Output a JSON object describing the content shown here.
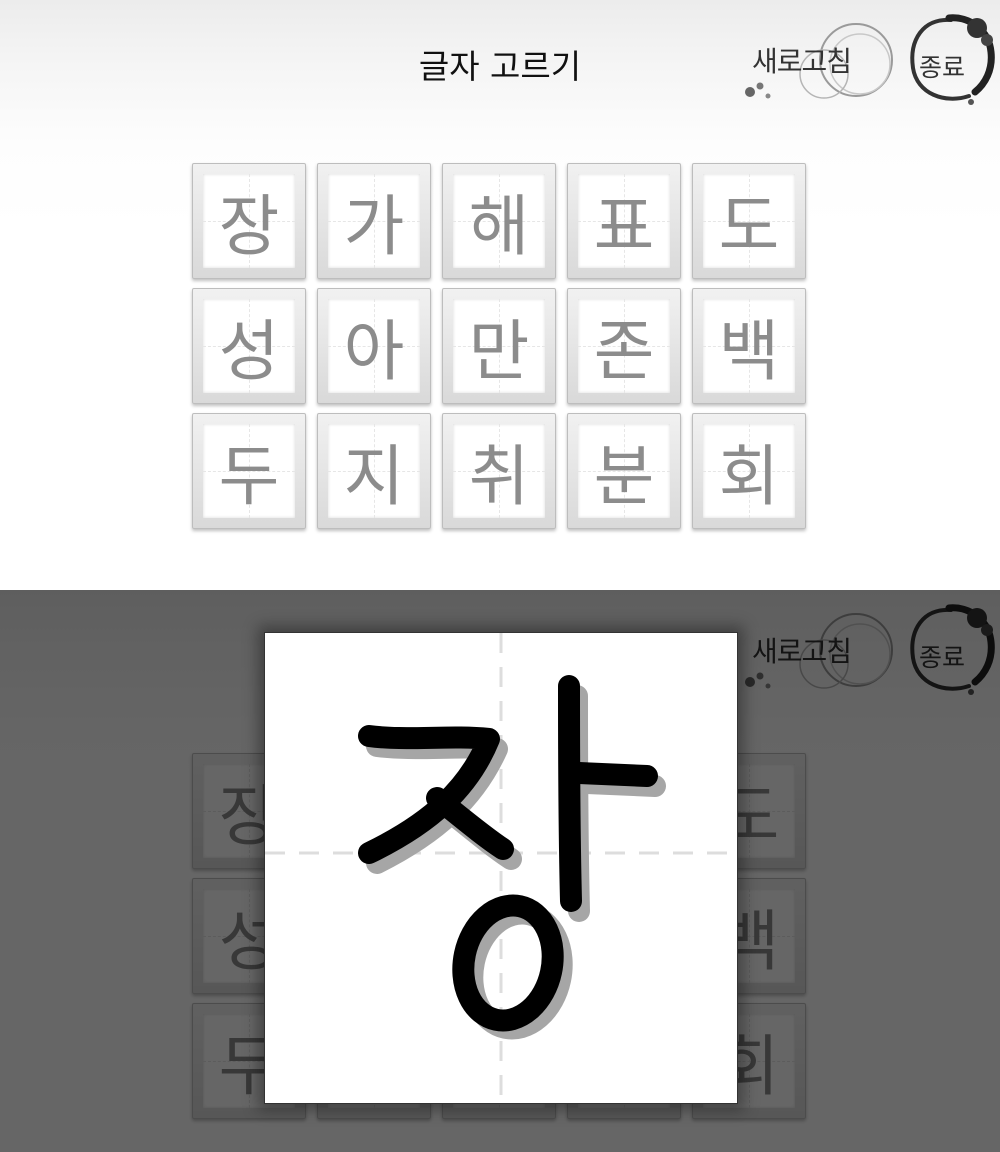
{
  "app": {
    "title": "글자 고르기",
    "refresh_label": "새로고침",
    "exit_label": "종료"
  },
  "tiles": [
    "장",
    "가",
    "해",
    "표",
    "도",
    "성",
    "아",
    "만",
    "존",
    "백",
    "두",
    "지",
    "취",
    "분",
    "회"
  ],
  "popup": {
    "selected_char": "장"
  },
  "icons": {
    "refresh": "ink-circle-icon",
    "exit": "ink-circle-icon"
  },
  "colors": {
    "tile_char": "#8c8c8c",
    "ink": "#000000",
    "overlay": "rgba(0,0,0,0.60)"
  }
}
